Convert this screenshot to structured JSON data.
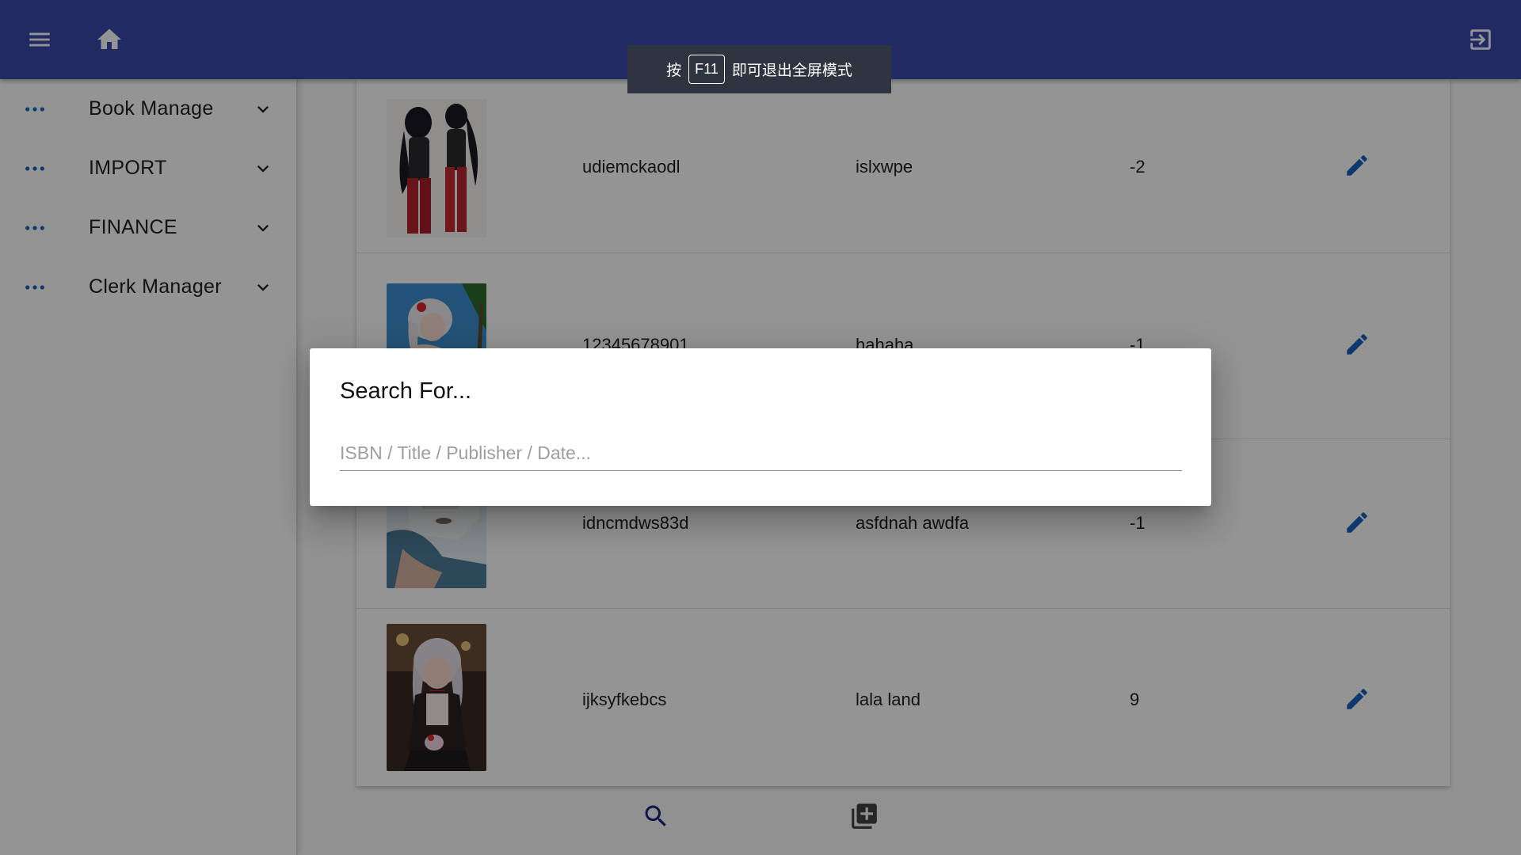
{
  "appbar": {
    "menu_icon": "menu-icon",
    "home_icon": "home-icon",
    "logout_icon": "exit-to-app-icon",
    "color": "#3949ab"
  },
  "sidebar": {
    "items": [
      {
        "label": "Book Manage"
      },
      {
        "label": "IMPORT"
      },
      {
        "label": "FINANCE"
      },
      {
        "label": "Clerk Manager"
      }
    ]
  },
  "table": {
    "rows": [
      {
        "isbn": "udiemckaodl",
        "publisher": "islxwpe",
        "count": "-2"
      },
      {
        "isbn": "12345678901",
        "publisher": "hahaha",
        "count": "-1"
      },
      {
        "isbn": "idncmdws83d",
        "publisher": "asfdnah awdfa",
        "count": "-1"
      },
      {
        "isbn": "ijksyfkebcs",
        "publisher": "lala land",
        "count": "9"
      }
    ]
  },
  "actions": {
    "search_icon": "search-icon",
    "add_icon": "library-add-icon"
  },
  "fullscreen_toast": {
    "prefix": "按",
    "key": "F11",
    "suffix": "即可退出全屏模式"
  },
  "search_dialog": {
    "title": "Search For...",
    "input_value": "",
    "placeholder": "ISBN / Title / Publisher / Date..."
  },
  "colors": {
    "accent": "#1565c0",
    "scrim": "rgba(0,0,0,0.42)"
  }
}
